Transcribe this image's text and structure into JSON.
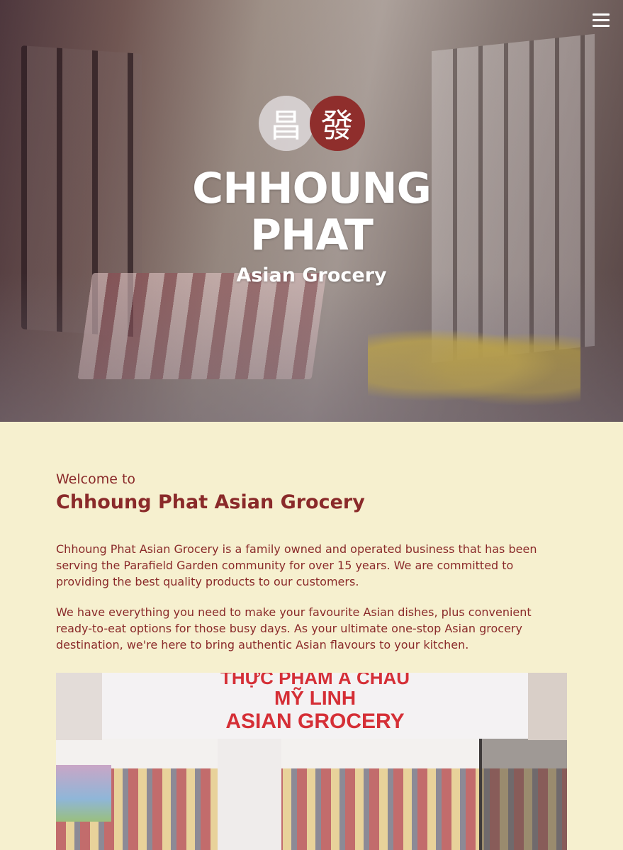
{
  "nav": {
    "menu_icon": "hamburger-menu-icon"
  },
  "hero": {
    "logo_chars": [
      "昌",
      "發"
    ],
    "brand_line1": "CHHOUNG",
    "brand_line2": "PHAT",
    "brand_sub": "Asian Grocery"
  },
  "intro": {
    "welcome": "Welcome to",
    "title": "Chhoung Phat Asian Grocery",
    "paragraphs": [
      "Chhoung Phat Asian Grocery is a family owned and operated business that has been serving the Parafield Garden community for over 15 years. We are committed to providing the best quality products to our customers.",
      "We have everything you need to make your favourite Asian dishes, plus convenient ready-to-eat options for those busy days. As your ultimate one-stop Asian grocery destination, we're here to bring authentic Asian flavours to your kitchen."
    ]
  },
  "store_photo": {
    "sign_line1": "THỰC PHẨM Á CHÂU",
    "sign_line2": "MỸ LINH",
    "sign_line3": "ASIAN GROCERY"
  },
  "colors": {
    "background": "#f6f0cf",
    "accent": "#8a2a2a",
    "seal_red": "#8f2e2c"
  }
}
